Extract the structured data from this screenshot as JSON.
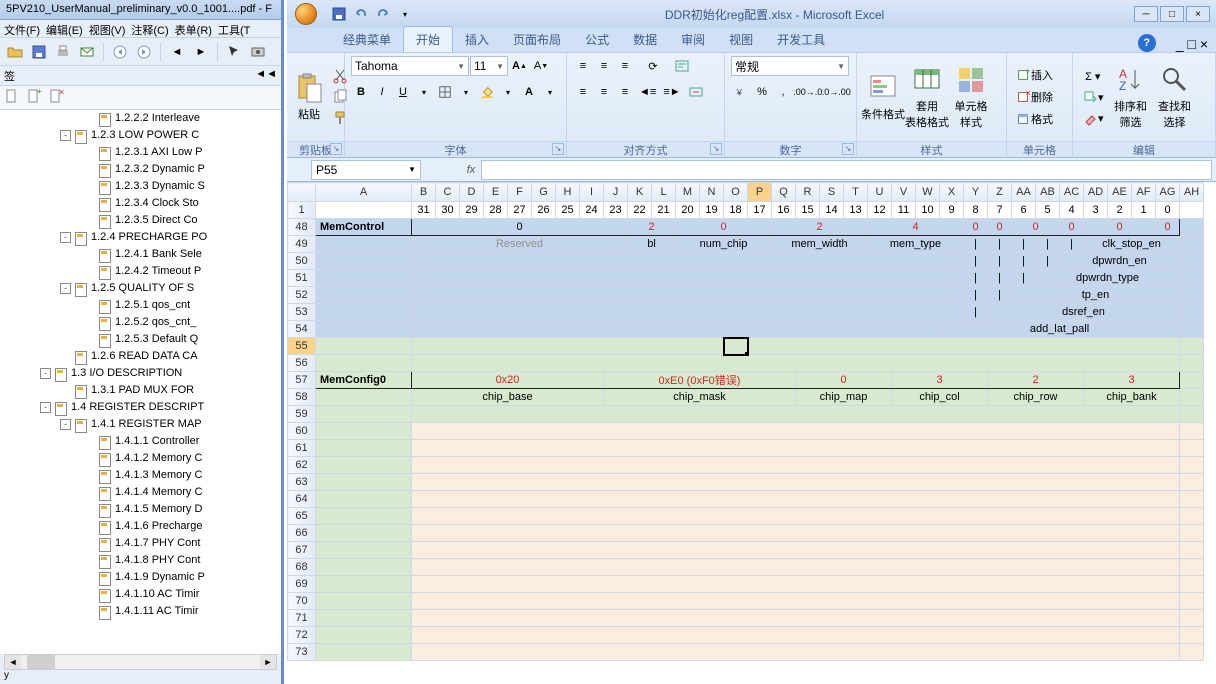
{
  "pdf": {
    "title": "5PV210_UserManual_preliminary_v0.0_1001....pdf - F",
    "menu": [
      "文件(F)",
      "编辑(E)",
      "视图(V)",
      "注释(C)",
      "表单(R)",
      "工具(T"
    ],
    "bookmark_tab": "签",
    "status": "y",
    "tree": [
      {
        "indent": 84,
        "toggle": "",
        "label": "1.2.2.2  Interleave"
      },
      {
        "indent": 60,
        "toggle": "-",
        "label": "1.2.3  LOW POWER C"
      },
      {
        "indent": 84,
        "toggle": "",
        "label": "1.2.3.1  AXI Low P"
      },
      {
        "indent": 84,
        "toggle": "",
        "label": "1.2.3.2  Dynamic P"
      },
      {
        "indent": 84,
        "toggle": "",
        "label": "1.2.3.3  Dynamic S"
      },
      {
        "indent": 84,
        "toggle": "",
        "label": "1.2.3.4  Clock Sto"
      },
      {
        "indent": 84,
        "toggle": "",
        "label": "1.2.3.5  Direct Co"
      },
      {
        "indent": 60,
        "toggle": "-",
        "label": "1.2.4  PRECHARGE PO"
      },
      {
        "indent": 84,
        "toggle": "",
        "label": "1.2.4.1  Bank Sele"
      },
      {
        "indent": 84,
        "toggle": "",
        "label": "1.2.4.2  Timeout P"
      },
      {
        "indent": 60,
        "toggle": "-",
        "label": "1.2.5  QUALITY OF S"
      },
      {
        "indent": 84,
        "toggle": "",
        "label": "1.2.5.1  qos_cnt"
      },
      {
        "indent": 84,
        "toggle": "",
        "label": "1.2.5.2  qos_cnt_"
      },
      {
        "indent": 84,
        "toggle": "",
        "label": "1.2.5.3  Default Q"
      },
      {
        "indent": 60,
        "toggle": "",
        "label": "1.2.6  READ DATA CA"
      },
      {
        "indent": 40,
        "toggle": "-",
        "label": "1.3  I/O DESCRIPTION"
      },
      {
        "indent": 60,
        "toggle": "",
        "label": "1.3.1  PAD MUX FOR"
      },
      {
        "indent": 40,
        "toggle": "-",
        "label": "1.4  REGISTER DESCRIPT"
      },
      {
        "indent": 60,
        "toggle": "-",
        "label": "1.4.1  REGISTER MAP"
      },
      {
        "indent": 84,
        "toggle": "",
        "label": "1.4.1.1  Controller"
      },
      {
        "indent": 84,
        "toggle": "",
        "label": "1.4.1.2  Memory C"
      },
      {
        "indent": 84,
        "toggle": "",
        "label": "1.4.1.3  Memory C"
      },
      {
        "indent": 84,
        "toggle": "",
        "label": "1.4.1.4  Memory C"
      },
      {
        "indent": 84,
        "toggle": "",
        "label": "1.4.1.5  Memory D"
      },
      {
        "indent": 84,
        "toggle": "",
        "label": "1.4.1.6  Precharge"
      },
      {
        "indent": 84,
        "toggle": "",
        "label": "1.4.1.7  PHY Cont"
      },
      {
        "indent": 84,
        "toggle": "",
        "label": "1.4.1.8  PHY Cont"
      },
      {
        "indent": 84,
        "toggle": "",
        "label": "1.4.1.9  Dynamic P"
      },
      {
        "indent": 84,
        "toggle": "",
        "label": "1.4.1.10  AC Timir"
      },
      {
        "indent": 84,
        "toggle": "",
        "label": "1.4.1.11  AC Timir"
      }
    ]
  },
  "excel": {
    "title": "DDR初始化reg配置.xlsx - Microsoft Excel",
    "tabs": [
      "经典菜单",
      "开始",
      "插入",
      "页面布局",
      "公式",
      "数据",
      "审阅",
      "视图",
      "开发工具"
    ],
    "active_tab": 1,
    "groups": {
      "clipboard": "剪贴板",
      "font": "字体",
      "align": "对齐方式",
      "number": "数字",
      "styles": "样式",
      "cells": "单元格",
      "editing": "编辑"
    },
    "paste": "粘贴",
    "font_name": "Tahoma",
    "font_size": "11",
    "num_fmt": "常规",
    "style_btns": {
      "cond": "条件格式",
      "tbl": "套用\n表格格式",
      "cell": "单元格\n样式"
    },
    "cell_btns": {
      "ins": "插入",
      "del": "删除",
      "fmt": "格式"
    },
    "edit_btns": {
      "sort": "排序和\n筛选",
      "find": "查找和\n选择"
    },
    "namebox": "P55",
    "cols": [
      "A",
      "B",
      "C",
      "D",
      "E",
      "F",
      "G",
      "H",
      "I",
      "J",
      "K",
      "L",
      "M",
      "N",
      "O",
      "P",
      "Q",
      "R",
      "S",
      "T",
      "U",
      "V",
      "W",
      "X",
      "Y",
      "Z",
      "AA",
      "AB",
      "AC",
      "AD",
      "AE",
      "AF",
      "AG",
      "AH"
    ],
    "rowhdr": [
      "1",
      "48",
      "49",
      "50",
      "51",
      "52",
      "53",
      "54",
      "55",
      "56",
      "57",
      "58",
      "59",
      "60",
      "61",
      "62",
      "63",
      "64",
      "65",
      "66",
      "67",
      "68",
      "69",
      "70",
      "71",
      "72",
      "73"
    ],
    "bits": [
      "31",
      "30",
      "29",
      "28",
      "27",
      "26",
      "25",
      "24",
      "23",
      "22",
      "21",
      "20",
      "19",
      "18",
      "17",
      "16",
      "15",
      "14",
      "13",
      "12",
      "11",
      "10",
      "9",
      "8",
      "7",
      "6",
      "5",
      "4",
      "3",
      "2",
      "1",
      "0"
    ],
    "r48": {
      "label": "MemControl",
      "c1": "0",
      "c2": "2",
      "c3": "0",
      "c4": "2",
      "c5": "4",
      "z0": "0",
      "z1": "0",
      "z2": "0",
      "z3": "0",
      "z4": "0",
      "z5": "0"
    },
    "r49": {
      "reserved": "Reserved",
      "bl": "bl",
      "num": "num_chip",
      "width": "mem_width",
      "type": "mem_type",
      "bar": "|",
      "clk": "clk_stop_en"
    },
    "r50": {
      "bar": "|",
      "dp": "dpwrdn_en"
    },
    "r51": {
      "bar": "|",
      "dpt": "dpwrdn_type"
    },
    "r52": {
      "bar": "|",
      "tp": "tp_en"
    },
    "r53": {
      "bar": "|",
      "ds": "dsref_en"
    },
    "r54": {
      "add": "add_lat_pall"
    },
    "r57": {
      "label": "MemConfig0",
      "base": "0x20",
      "mask": "0xE0 (0xF0错误)",
      "map": "0",
      "col": "3",
      "row": "2",
      "bank": "3"
    },
    "r58": {
      "base": "chip_base",
      "mask": "chip_mask",
      "map": "chip_map",
      "col": "chip_col",
      "row": "chip_row",
      "bank": "chip_bank"
    }
  }
}
